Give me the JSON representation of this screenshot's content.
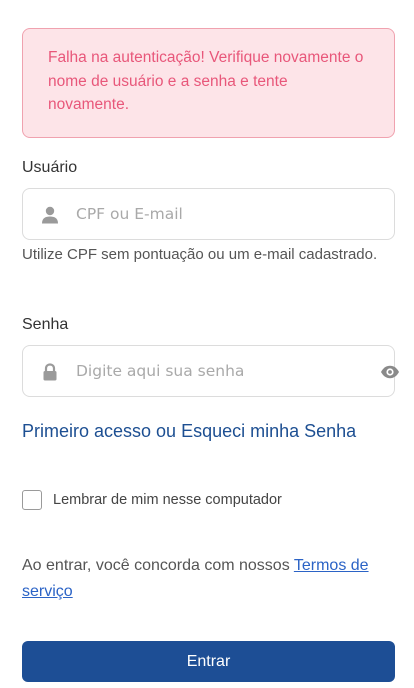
{
  "alert": {
    "message": "Falha na autenticação! Verifique novamente o nome de usuário e a senha e tente novamente."
  },
  "username": {
    "label": "Usuário",
    "placeholder": "CPF ou E-mail",
    "value": "",
    "icon": "user-icon",
    "help": "Utilize CPF sem pontuação ou um e-mail cadastrado."
  },
  "password": {
    "label": "Senha",
    "placeholder": "Digite aqui sua senha",
    "value": "",
    "icon": "lock-icon",
    "toggle_icon": "eye-icon"
  },
  "links": {
    "forgot": "Primeiro acesso ou Esqueci minha Senha"
  },
  "remember": {
    "label": "Lembrar de mim nesse computador",
    "checked": false
  },
  "terms": {
    "prefix": "Ao entrar, você concorda com nossos ",
    "link": "Termos de serviço"
  },
  "submit": {
    "label": "Entrar"
  },
  "colors": {
    "alert_bg": "#fde4e8",
    "alert_text": "#e8577a",
    "link": "#1d4f92",
    "button": "#1d4e95"
  }
}
